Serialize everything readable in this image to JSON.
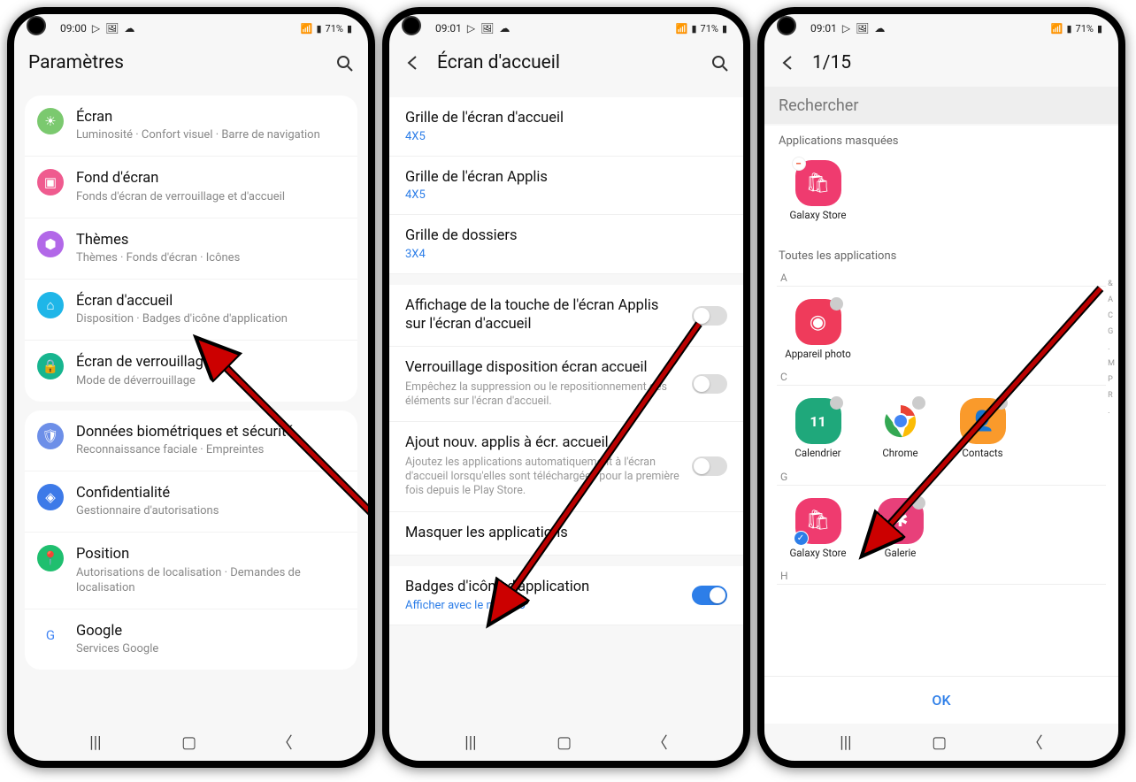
{
  "status": {
    "time": "09:00",
    "time2": "09:01",
    "time3": "09:01",
    "battery": "71%"
  },
  "p1": {
    "title": "Paramètres",
    "groups": [
      [
        {
          "icon": "#7bc96f",
          "glyph": "☀",
          "title": "Écran",
          "sub": "Luminosité  ·  Confort visuel  ·  Barre de navigation"
        },
        {
          "icon": "#ef5b8f",
          "glyph": "▣",
          "title": "Fond d'écran",
          "sub": "Fonds d'écran de verrouillage et d'accueil"
        },
        {
          "icon": "#b268e8",
          "glyph": "⬢",
          "title": "Thèmes",
          "sub": "Thèmes  ·  Fonds d'écran  ·  Icônes"
        },
        {
          "icon": "#1fb6e8",
          "glyph": "⌂",
          "title": "Écran d'accueil",
          "sub": "Disposition  ·  Badges d'icône d'application"
        },
        {
          "icon": "#17b58f",
          "glyph": "🔒",
          "title": "Écran de verrouillage",
          "sub": "Mode de déverrouillage"
        }
      ],
      [
        {
          "icon": "#6d8fe8",
          "glyph": "🛡",
          "title": "Données biométriques et sécurité",
          "sub": "Reconnaissance faciale  ·  Empreintes"
        },
        {
          "icon": "#3d7ae8",
          "glyph": "◈",
          "title": "Confidentialité",
          "sub": "Gestionnaire d'autorisations"
        },
        {
          "icon": "#1fbf6f",
          "glyph": "📍",
          "title": "Position",
          "sub": "Autorisations de localisation  ·  Demandes de localisation"
        },
        {
          "icon": "#fff",
          "glyph": "G",
          "title": "Google",
          "sub": "Services Google",
          "textcolor": "#4285f4"
        }
      ]
    ]
  },
  "p2": {
    "title": "Écran d'accueil",
    "rows": [
      {
        "type": "gap"
      },
      {
        "title": "Grille de l'écran d'accueil",
        "val": "4X5"
      },
      {
        "title": "Grille de l'écran Applis",
        "val": "4X5"
      },
      {
        "title": "Grille de dossiers",
        "val": "3X4"
      },
      {
        "type": "gap"
      },
      {
        "title": "Affichage de la touche de l'écran Applis sur l'écran d'accueil",
        "toggle": false
      },
      {
        "title": "Verrouillage disposition écran accueil",
        "desc": "Empêchez la suppression ou le repositionnement des éléments sur l'écran d'accueil.",
        "toggle": false
      },
      {
        "title": "Ajout nouv. applis à écr. accueil",
        "desc": "Ajoutez les applications automatiquement à l'écran d'accueil lorsqu'elles sont téléchargées pour la première fois depuis le Play Store.",
        "toggle": false
      },
      {
        "title": "Masquer les applications"
      },
      {
        "type": "gap"
      },
      {
        "title": "Badges d'icône d'application",
        "val": "Afficher avec le numéro",
        "toggle": true
      }
    ]
  },
  "p3": {
    "title": "1/15",
    "search": "Rechercher",
    "hidden_label": "Applications masquées",
    "all_label": "Toutes les applications",
    "ok": "OK",
    "hidden": [
      {
        "name": "Galaxy Store",
        "color": "#ef3b6f",
        "glyph": "🛍",
        "remove": true
      }
    ],
    "sections": [
      {
        "letter": "A",
        "apps": [
          {
            "name": "Appareil photo",
            "color": "#ef3b5b",
            "glyph": "◉"
          }
        ]
      },
      {
        "letter": "C",
        "apps": [
          {
            "name": "Calendrier",
            "color": "#1fa87b",
            "glyph": "11"
          },
          {
            "name": "Chrome",
            "color": "#fff",
            "glyph": "◯",
            "chrome": true
          },
          {
            "name": "Contacts",
            "color": "#fa9a2b",
            "glyph": "👤"
          }
        ]
      },
      {
        "letter": "G",
        "apps": [
          {
            "name": "Galaxy Store",
            "color": "#ef3b6f",
            "glyph": "🛍",
            "checked": true
          },
          {
            "name": "Galerie",
            "color": "#e8407a",
            "glyph": "✱"
          }
        ]
      },
      {
        "letter": "H",
        "apps": []
      }
    ],
    "index": [
      "&",
      "A",
      "C",
      "G",
      ".",
      "M",
      "P",
      "R",
      "."
    ]
  }
}
